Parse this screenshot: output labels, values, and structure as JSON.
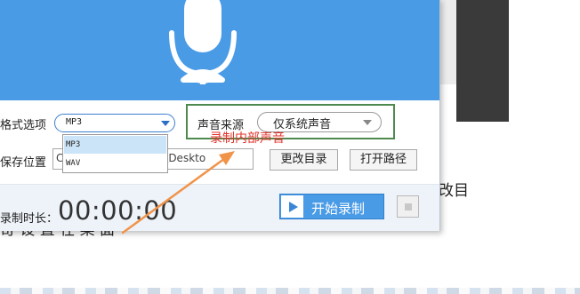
{
  "background": {
    "text_right": "改目",
    "text_left": "奇 设 置 在 桌 面"
  },
  "dialog": {
    "format": {
      "label": "格式选项",
      "selected": "MP3",
      "options": [
        "MP3",
        "WAV"
      ]
    },
    "sound_source": {
      "label": "声音来源",
      "selected": "仅系统声音"
    },
    "save": {
      "label": "保存位置",
      "path_prefix": "C",
      "path_value": "or\\Deskto",
      "change_dir_label": "更改目录",
      "open_path_label": "打开路径"
    },
    "record": {
      "duration_label": "录制时长：",
      "timer": "00:00:00",
      "start_label": "开始录制"
    }
  },
  "annotation": {
    "text": "录制内部声音",
    "color": "#e3332b",
    "arrow_color": "#f0944a"
  },
  "colors": {
    "header_blue": "#4a9be6",
    "highlight_green": "#4e8a4e"
  },
  "icons": [
    "microphone-icon",
    "chevron-down-icon",
    "play-icon",
    "stop-icon"
  ]
}
